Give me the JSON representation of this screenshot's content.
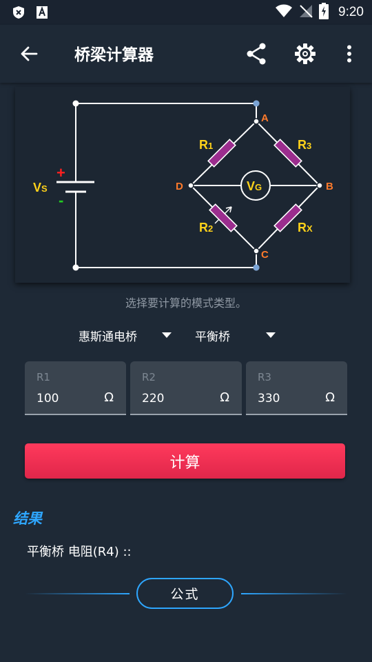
{
  "status_bar": {
    "time": "9:20",
    "icons": [
      "shield-x-icon",
      "font-a-icon",
      "wifi-icon",
      "no-signal-icon",
      "battery-charging-icon"
    ]
  },
  "app_bar": {
    "title": "桥梁计算器",
    "icons": [
      "back-arrow-icon",
      "share-icon",
      "gear-icon",
      "more-vert-icon"
    ]
  },
  "diagram": {
    "labels": {
      "a": "A",
      "b": "B",
      "c": "C",
      "d": "D",
      "r1": "R",
      "r1_sub": "1",
      "r2": "R",
      "r2_sub": "2",
      "r3": "R",
      "r3_sub": "3",
      "rx": "R",
      "rx_sub": "X",
      "vg": "V",
      "vg_sub": "G",
      "vs": "V",
      "vs_sub": "S",
      "plus": "+",
      "minus": "-"
    },
    "colors": {
      "wire": "#ffffff",
      "resistor": "#9b2d8e",
      "node_label": "#ff7a2b",
      "component_label": "#ffd21a",
      "plus": "#ff2020",
      "minus": "#22cc22"
    }
  },
  "hint": "选择要计算的模式类型。",
  "dropdowns": {
    "mode": "惠斯通电桥",
    "type": "平衡桥"
  },
  "fields": [
    {
      "label": "R1",
      "value": "100",
      "unit": "Ω"
    },
    {
      "label": "R2",
      "value": "220",
      "unit": "Ω"
    },
    {
      "label": "R3",
      "value": "330",
      "unit": "Ω"
    }
  ],
  "calculate_label": "计算",
  "results": {
    "title": "结果",
    "line": "平衡桥 电阻(R4) ::"
  },
  "formula_label": "公式",
  "colors": {
    "accent": "#2ea6ff",
    "button": "#f0304f",
    "background": "#1e2936"
  }
}
